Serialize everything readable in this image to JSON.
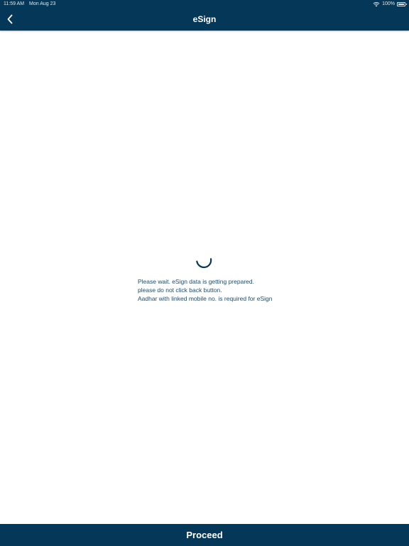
{
  "status_bar": {
    "time": "11:59 AM",
    "date": "Mon Aug 23",
    "battery": "100%",
    "battery_level": 1.0,
    "icons": [
      "wifi-icon",
      "battery-icon"
    ]
  },
  "header": {
    "title": "eSign",
    "back_icon": "chevron-left-icon"
  },
  "main": {
    "spinner_icon": "loading-spinner-icon",
    "message_lines": [
      "Please wait. eSign data is getting prepared.",
      "please do not click back button.",
      "Aadhar with linked mobile no. is required for eSign"
    ]
  },
  "footer": {
    "proceed_label": "Proceed"
  },
  "colors": {
    "primary": "#053858",
    "text": "#1f4a66",
    "background": "#ffffff"
  }
}
